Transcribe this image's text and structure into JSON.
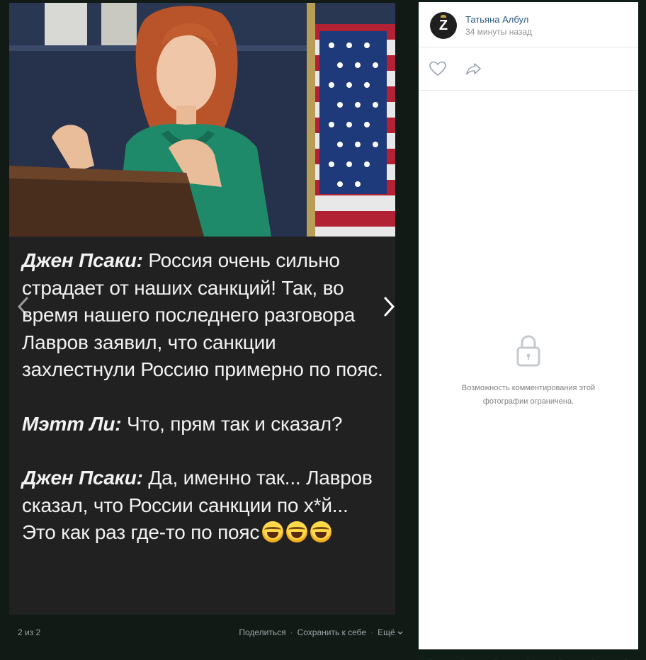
{
  "viewer": {
    "counter": "2 из 2",
    "actions": {
      "share": "Поделиться",
      "save": "Сохранить к себе",
      "more": "Ещё"
    }
  },
  "meme": {
    "paragraphs": [
      {
        "speaker": "Джен Псаки:",
        "text": " Россия очень сильно страдает от наших санкций! Так, во время нашего последнего разговора Лавров заявил, что санкции захлестнули Россию примерно по пояс."
      },
      {
        "speaker": "Мэтт Ли:",
        "text": " Что, прям так и сказал?"
      },
      {
        "speaker": "Джен Псаки:",
        "text": " Да, именно так... Лавров сказал, что России санкции по х*й... Это как раз где-то по пояс"
      }
    ],
    "emoji_count": 3
  },
  "panel": {
    "author": {
      "avatar_letter": "Z",
      "name": "Татьяна Албул",
      "time": "34 минуты назад"
    },
    "restricted_text": "Возможность комментирования этой фотографии ограничена."
  },
  "colors": {
    "link": "#2a5885",
    "panel_bg": "#ffffff",
    "viewer_bg": "#212121"
  },
  "icons": {
    "like": "heart-icon",
    "share": "share-arrow-icon",
    "lock": "lock-icon",
    "prev": "chevron-left-icon",
    "next": "chevron-right-icon"
  }
}
